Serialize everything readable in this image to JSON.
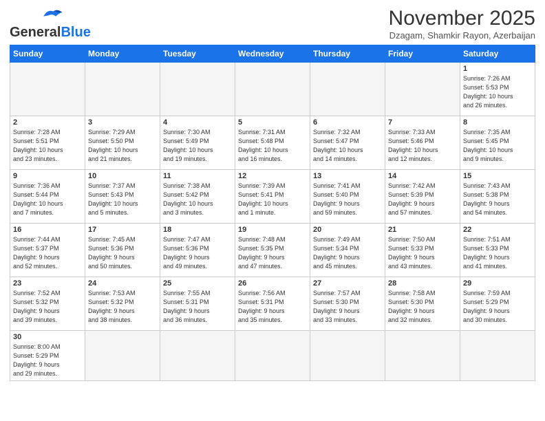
{
  "header": {
    "logo_general": "General",
    "logo_blue": "Blue",
    "month_title": "November 2025",
    "location": "Dzagam, Shamkir Rayon, Azerbaijan"
  },
  "days_of_week": [
    "Sunday",
    "Monday",
    "Tuesday",
    "Wednesday",
    "Thursday",
    "Friday",
    "Saturday"
  ],
  "weeks": [
    [
      {
        "day": "",
        "info": ""
      },
      {
        "day": "",
        "info": ""
      },
      {
        "day": "",
        "info": ""
      },
      {
        "day": "",
        "info": ""
      },
      {
        "day": "",
        "info": ""
      },
      {
        "day": "",
        "info": ""
      },
      {
        "day": "1",
        "info": "Sunrise: 7:26 AM\nSunset: 5:53 PM\nDaylight: 10 hours\nand 26 minutes."
      }
    ],
    [
      {
        "day": "2",
        "info": "Sunrise: 7:28 AM\nSunset: 5:51 PM\nDaylight: 10 hours\nand 23 minutes."
      },
      {
        "day": "3",
        "info": "Sunrise: 7:29 AM\nSunset: 5:50 PM\nDaylight: 10 hours\nand 21 minutes."
      },
      {
        "day": "4",
        "info": "Sunrise: 7:30 AM\nSunset: 5:49 PM\nDaylight: 10 hours\nand 19 minutes."
      },
      {
        "day": "5",
        "info": "Sunrise: 7:31 AM\nSunset: 5:48 PM\nDaylight: 10 hours\nand 16 minutes."
      },
      {
        "day": "6",
        "info": "Sunrise: 7:32 AM\nSunset: 5:47 PM\nDaylight: 10 hours\nand 14 minutes."
      },
      {
        "day": "7",
        "info": "Sunrise: 7:33 AM\nSunset: 5:46 PM\nDaylight: 10 hours\nand 12 minutes."
      },
      {
        "day": "8",
        "info": "Sunrise: 7:35 AM\nSunset: 5:45 PM\nDaylight: 10 hours\nand 9 minutes."
      }
    ],
    [
      {
        "day": "9",
        "info": "Sunrise: 7:36 AM\nSunset: 5:44 PM\nDaylight: 10 hours\nand 7 minutes."
      },
      {
        "day": "10",
        "info": "Sunrise: 7:37 AM\nSunset: 5:43 PM\nDaylight: 10 hours\nand 5 minutes."
      },
      {
        "day": "11",
        "info": "Sunrise: 7:38 AM\nSunset: 5:42 PM\nDaylight: 10 hours\nand 3 minutes."
      },
      {
        "day": "12",
        "info": "Sunrise: 7:39 AM\nSunset: 5:41 PM\nDaylight: 10 hours\nand 1 minute."
      },
      {
        "day": "13",
        "info": "Sunrise: 7:41 AM\nSunset: 5:40 PM\nDaylight: 9 hours\nand 59 minutes."
      },
      {
        "day": "14",
        "info": "Sunrise: 7:42 AM\nSunset: 5:39 PM\nDaylight: 9 hours\nand 57 minutes."
      },
      {
        "day": "15",
        "info": "Sunrise: 7:43 AM\nSunset: 5:38 PM\nDaylight: 9 hours\nand 54 minutes."
      }
    ],
    [
      {
        "day": "16",
        "info": "Sunrise: 7:44 AM\nSunset: 5:37 PM\nDaylight: 9 hours\nand 52 minutes."
      },
      {
        "day": "17",
        "info": "Sunrise: 7:45 AM\nSunset: 5:36 PM\nDaylight: 9 hours\nand 50 minutes."
      },
      {
        "day": "18",
        "info": "Sunrise: 7:47 AM\nSunset: 5:36 PM\nDaylight: 9 hours\nand 49 minutes."
      },
      {
        "day": "19",
        "info": "Sunrise: 7:48 AM\nSunset: 5:35 PM\nDaylight: 9 hours\nand 47 minutes."
      },
      {
        "day": "20",
        "info": "Sunrise: 7:49 AM\nSunset: 5:34 PM\nDaylight: 9 hours\nand 45 minutes."
      },
      {
        "day": "21",
        "info": "Sunrise: 7:50 AM\nSunset: 5:33 PM\nDaylight: 9 hours\nand 43 minutes."
      },
      {
        "day": "22",
        "info": "Sunrise: 7:51 AM\nSunset: 5:33 PM\nDaylight: 9 hours\nand 41 minutes."
      }
    ],
    [
      {
        "day": "23",
        "info": "Sunrise: 7:52 AM\nSunset: 5:32 PM\nDaylight: 9 hours\nand 39 minutes."
      },
      {
        "day": "24",
        "info": "Sunrise: 7:53 AM\nSunset: 5:32 PM\nDaylight: 9 hours\nand 38 minutes."
      },
      {
        "day": "25",
        "info": "Sunrise: 7:55 AM\nSunset: 5:31 PM\nDaylight: 9 hours\nand 36 minutes."
      },
      {
        "day": "26",
        "info": "Sunrise: 7:56 AM\nSunset: 5:31 PM\nDaylight: 9 hours\nand 35 minutes."
      },
      {
        "day": "27",
        "info": "Sunrise: 7:57 AM\nSunset: 5:30 PM\nDaylight: 9 hours\nand 33 minutes."
      },
      {
        "day": "28",
        "info": "Sunrise: 7:58 AM\nSunset: 5:30 PM\nDaylight: 9 hours\nand 32 minutes."
      },
      {
        "day": "29",
        "info": "Sunrise: 7:59 AM\nSunset: 5:29 PM\nDaylight: 9 hours\nand 30 minutes."
      }
    ],
    [
      {
        "day": "30",
        "info": "Sunrise: 8:00 AM\nSunset: 5:29 PM\nDaylight: 9 hours\nand 29 minutes."
      },
      {
        "day": "",
        "info": ""
      },
      {
        "day": "",
        "info": ""
      },
      {
        "day": "",
        "info": ""
      },
      {
        "day": "",
        "info": ""
      },
      {
        "day": "",
        "info": ""
      },
      {
        "day": "",
        "info": ""
      }
    ]
  ]
}
